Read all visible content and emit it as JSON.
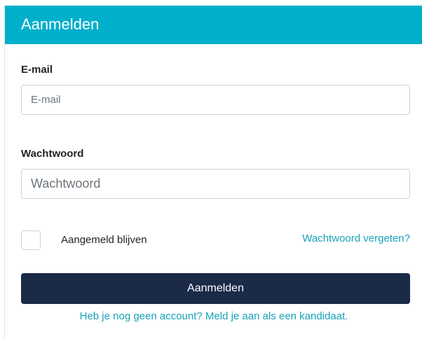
{
  "header": {
    "title": "Aanmelden"
  },
  "form": {
    "email": {
      "label": "E-mail",
      "placeholder": "E-mail",
      "value": ""
    },
    "password": {
      "label": "Wachtwoord",
      "placeholder": "Wachtwoord",
      "value": ""
    },
    "remember": {
      "label": "Aangemeld blijven",
      "checked": false
    },
    "forgot_link": "Wachtwoord vergeten?",
    "submit_label": "Aanmelden",
    "register_link": "Heb je nog geen account? Meld je aan als een kandidaat."
  },
  "colors": {
    "header_bg": "#00b0cb",
    "button_bg": "#1a2a47",
    "link": "#17a2b8"
  }
}
